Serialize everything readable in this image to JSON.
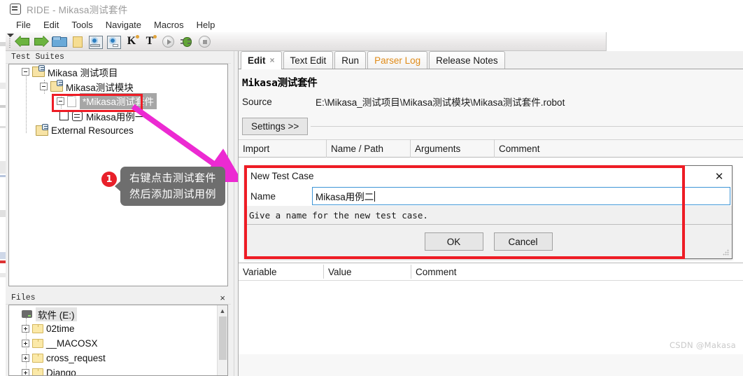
{
  "window": {
    "title": "RIDE - Mikasa测试套件",
    "icon": "robot-icon"
  },
  "menubar": {
    "items": [
      {
        "label": "File"
      },
      {
        "label": "Edit"
      },
      {
        "label": "Tools"
      },
      {
        "label": "Navigate"
      },
      {
        "label": "Macros"
      },
      {
        "label": "Help"
      }
    ]
  },
  "toolbar": {
    "buttons": [
      {
        "name": "back-arrow-icon",
        "tip": "Back"
      },
      {
        "name": "forward-arrow-icon",
        "tip": "Forward"
      },
      {
        "name": "open-folder-icon",
        "tip": "Open Directory"
      },
      {
        "name": "new-folder-icon",
        "tip": "New Project"
      },
      {
        "name": "save-icon",
        "tip": "Save"
      },
      {
        "name": "save-all-icon",
        "tip": "Save All"
      },
      {
        "name": "search-keyword-icon",
        "tip": "K",
        "letter": "K"
      },
      {
        "name": "search-test-icon",
        "tip": "T",
        "letter": "T"
      },
      {
        "name": "run-icon",
        "tip": "Run"
      },
      {
        "name": "debug-icon",
        "tip": "Debug"
      },
      {
        "name": "stop-icon",
        "tip": "Stop"
      }
    ]
  },
  "test_suites_panel": {
    "caption": "Test Suites",
    "close_label": "×",
    "tree": [
      {
        "label": "Mikasa 测试项目",
        "icon": "project-folder-icon",
        "indent": 0,
        "expander": "minus"
      },
      {
        "label": "Mikasa测试模块",
        "icon": "project-folder-icon",
        "indent": 1,
        "expander": "minus"
      },
      {
        "label": "*Mikasa测试套件",
        "icon": "file-icon",
        "indent": 2,
        "expander": "minus",
        "selected": true
      },
      {
        "label": "Mikasa用例一",
        "icon": "robot-icon",
        "indent": 3,
        "expander": "none",
        "checkbox": true
      },
      {
        "label": "External Resources",
        "icon": "project-folder-icon",
        "indent": 0,
        "expander": "none"
      }
    ]
  },
  "files_panel": {
    "caption": "Files",
    "close_label": "×",
    "tree": [
      {
        "label": "软件 (E:)",
        "icon": "drive-icon",
        "indent": 0,
        "expander": "none",
        "highlighted": true
      },
      {
        "label": "02time",
        "icon": "folder-icon",
        "indent": 1,
        "expander": "plus"
      },
      {
        "label": "__MACOSX",
        "icon": "folder-icon",
        "indent": 1,
        "expander": "plus"
      },
      {
        "label": "cross_request",
        "icon": "folder-icon",
        "indent": 1,
        "expander": "plus"
      },
      {
        "label": "Django",
        "icon": "folder-icon",
        "indent": 1,
        "expander": "plus"
      }
    ]
  },
  "editor": {
    "tabs": [
      {
        "label": "Edit",
        "active": true,
        "closable": true,
        "close_label": "×"
      },
      {
        "label": "Text Edit",
        "active": false,
        "closable": false
      },
      {
        "label": "Run",
        "active": false,
        "closable": false
      },
      {
        "label": "Parser Log",
        "active": false,
        "closable": false,
        "warn": true
      },
      {
        "label": "Release Notes",
        "active": false,
        "closable": false
      }
    ],
    "doc_title": "Mikasa测试套件",
    "source_label": "Source",
    "source_value": "E:\\Mikasa_测试项目\\Mikasa测试模块\\Mikasa测试套件.robot",
    "settings_button": "Settings >>",
    "import_columns": [
      "Import",
      "Name / Path",
      "Arguments",
      "Comment"
    ],
    "variable_columns": [
      "Variable",
      "Value",
      "Comment"
    ]
  },
  "dialog": {
    "title": "New Test Case",
    "close_label": "✕",
    "name_label": "Name",
    "name_value": "Mikasa用例二",
    "help_text": "Give a name for the new test case.",
    "ok_label": "OK",
    "cancel_label": "Cancel"
  },
  "annotation": {
    "badge": "1",
    "line1": "右键点击测试套件",
    "line2": "然后添加测试用例",
    "arrow_color": "#ec2ad2",
    "highlight_color": "#ee1c25",
    "badge_color": "#e8202a"
  },
  "watermark": "CSDN @Makasa"
}
